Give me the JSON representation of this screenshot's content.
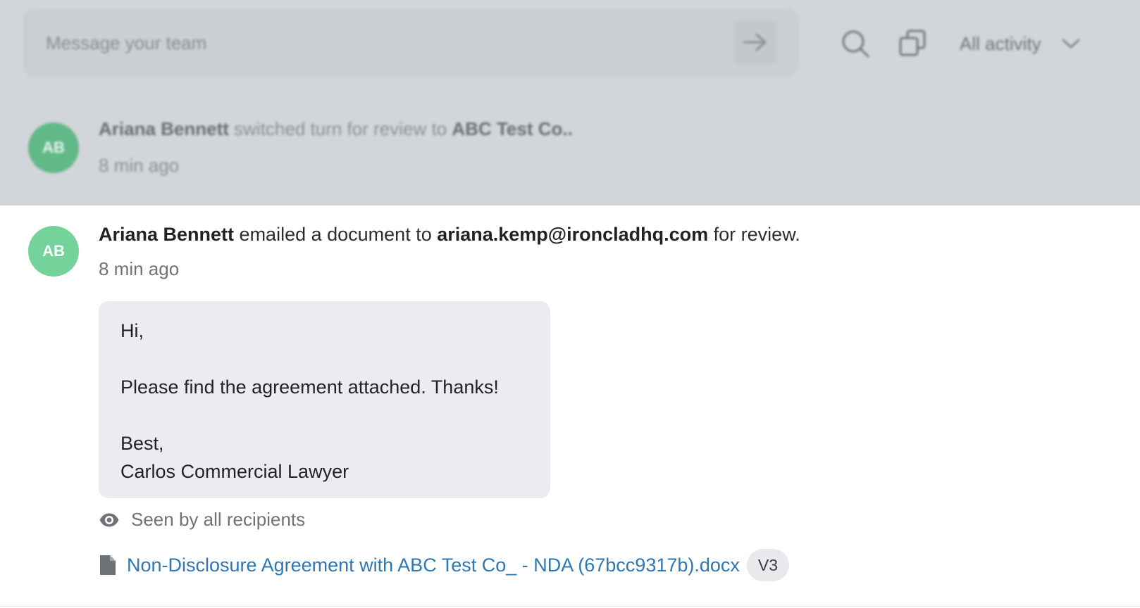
{
  "composer": {
    "placeholder": "Message your team"
  },
  "toolbar": {
    "send_icon": "arrow-right-icon",
    "search_icon": "search-icon",
    "copy_icon": "copy-icon",
    "filter_label": "All activity",
    "filter_icon": "chevron-down-icon"
  },
  "previous_event": {
    "avatar_initials": "AB",
    "actor": "Ariana Bennett",
    "action": " switched turn for review to ",
    "target": "ABC Test Co..",
    "time": "8 min ago"
  },
  "event": {
    "avatar_initials": "AB",
    "actor": "Ariana Bennett",
    "action": " emailed a document to ",
    "recipient": "ariana.kemp@ironcladhq.com",
    "suffix": " for review.",
    "time": "8 min ago",
    "email_body": {
      "greeting": "Hi,",
      "message": "Please find the agreement attached. Thanks!",
      "signoff": "Best,",
      "signature": "Carlos Commercial Lawyer"
    },
    "seen_status": "Seen by all recipients",
    "attachment": {
      "filename": "Non-Disclosure Agreement with ABC Test Co_ - NDA (67bcc9317b).docx",
      "version": "V3"
    }
  },
  "colors": {
    "avatar": "#74d39b",
    "link": "#2e77b6",
    "overlay": "#d2d5d9"
  }
}
